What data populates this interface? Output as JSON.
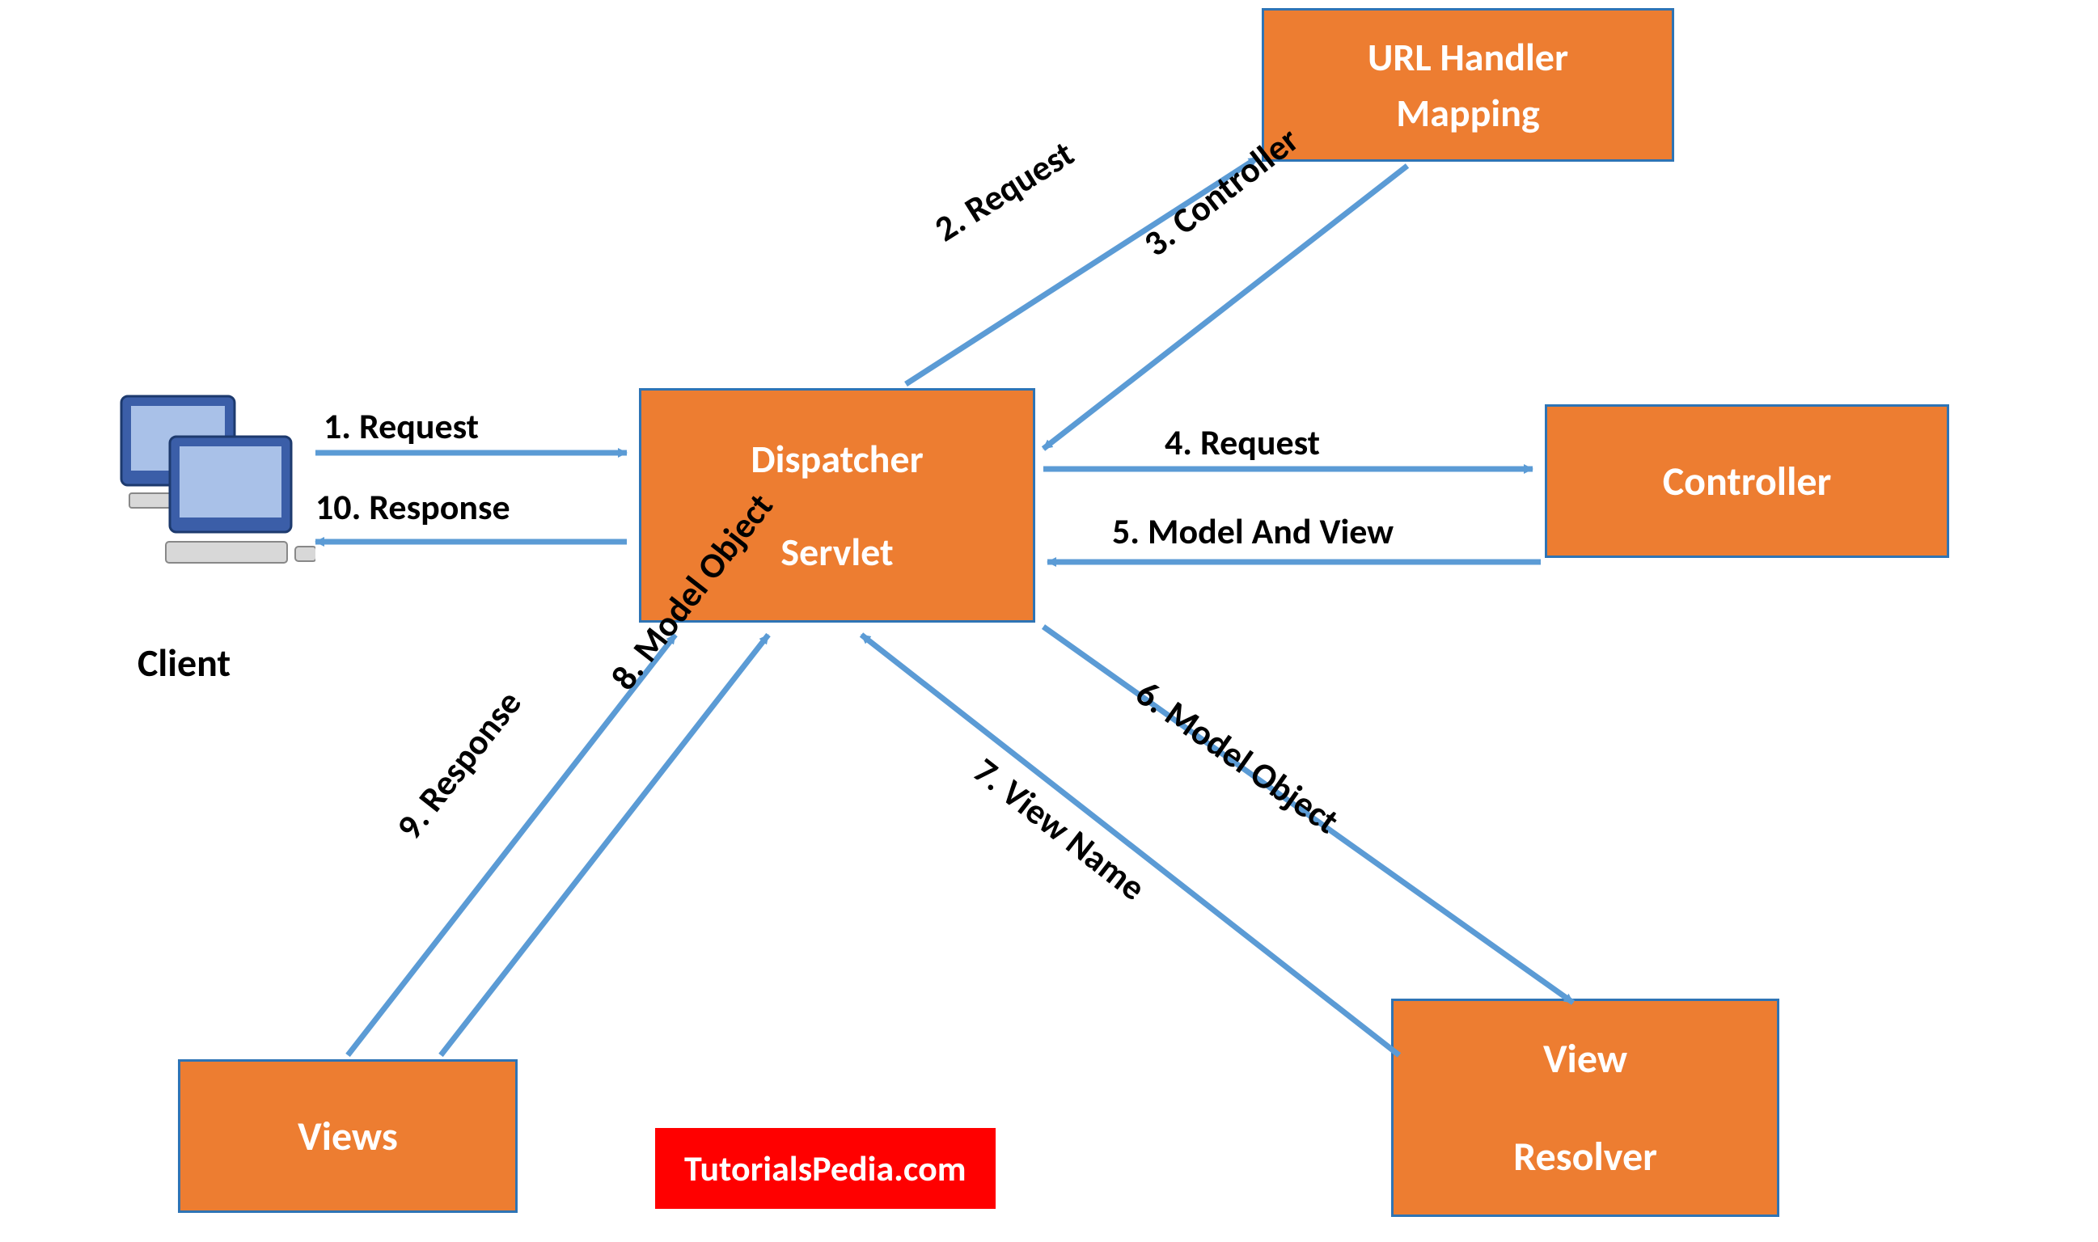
{
  "nodes": {
    "client": {
      "label": "Client"
    },
    "dispatcher": {
      "line1": "Dispatcher",
      "line2": "Servlet"
    },
    "url_handler": {
      "line1": "URL Handler",
      "line2": "Mapping"
    },
    "controller": {
      "label": "Controller"
    },
    "views": {
      "label": "Views"
    },
    "view_resolver": {
      "line1": "View",
      "line2": "Resolver"
    }
  },
  "edges": {
    "e1": "1. Request",
    "e2": "2. Request",
    "e3": "3. Controller",
    "e4": "4. Request",
    "e5": "5. Model And View",
    "e6": "6. Model Object",
    "e7": "7. View Name",
    "e8": "8. Model Object",
    "e9": "9. Response",
    "e10": "10. Response"
  },
  "watermark": "TutorialsPedia.com",
  "colors": {
    "box_fill": "#ed7d31",
    "box_border": "#2e74b5",
    "arrow": "#5b9bd5",
    "watermark_bg": "#ff0000"
  }
}
